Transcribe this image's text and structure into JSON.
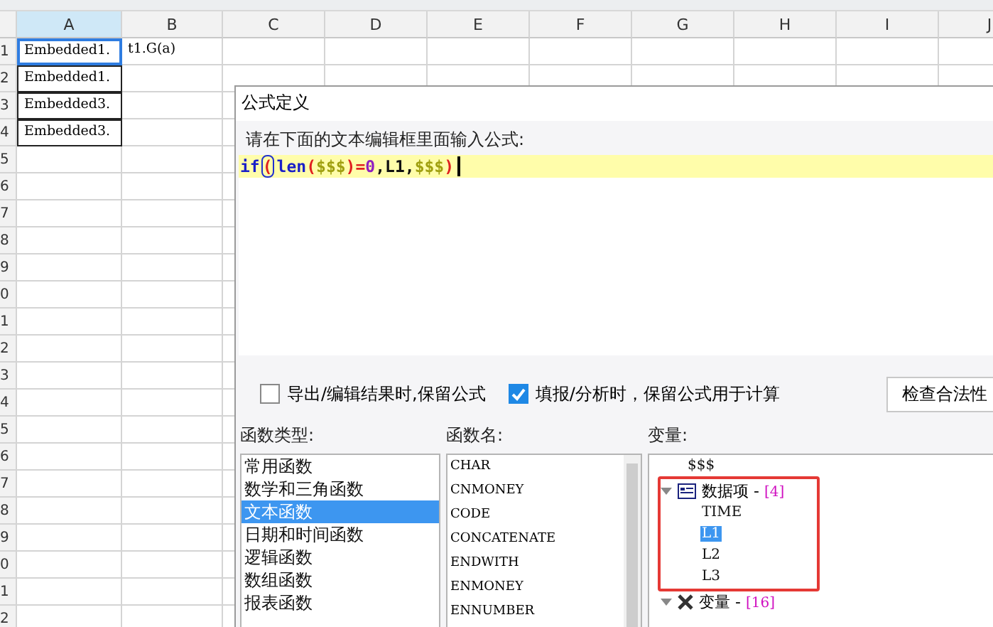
{
  "sheet": {
    "columns": [
      {
        "label": "A",
        "selected": true
      },
      {
        "label": "B",
        "selected": false
      },
      {
        "label": "C",
        "selected": false
      },
      {
        "label": "D",
        "selected": false
      },
      {
        "label": "E",
        "selected": false
      },
      {
        "label": "F",
        "selected": false
      },
      {
        "label": "G",
        "selected": false
      },
      {
        "label": "H",
        "selected": false
      },
      {
        "label": "I",
        "selected": false
      },
      {
        "label": "J",
        "selected": false
      }
    ],
    "rows": [
      {
        "label": "1",
        "cells": [
          {
            "text": "Embedded1.",
            "selected": true
          },
          {
            "text": "t1.G(a)",
            "selected": false
          }
        ]
      },
      {
        "label": "2",
        "cells": [
          {
            "text": "Embedded1.",
            "selected": false
          }
        ]
      },
      {
        "label": "3",
        "cells": [
          {
            "text": "Embedded3.",
            "selected": false
          }
        ]
      },
      {
        "label": "4",
        "cells": [
          {
            "text": "Embedded3.",
            "selected": false
          }
        ]
      },
      {
        "label": "5"
      },
      {
        "label": "6"
      },
      {
        "label": "7"
      },
      {
        "label": "8"
      },
      {
        "label": "9"
      },
      {
        "label": "0"
      },
      {
        "label": "1"
      },
      {
        "label": "2"
      },
      {
        "label": "3"
      },
      {
        "label": "4"
      },
      {
        "label": "5"
      },
      {
        "label": "6"
      },
      {
        "label": "7"
      },
      {
        "label": "8"
      },
      {
        "label": "9"
      },
      {
        "label": "0"
      },
      {
        "label": "1"
      },
      {
        "label": "2"
      }
    ]
  },
  "dialog": {
    "title": "公式定义",
    "prompt": "请在下面的文本编辑框里面输入公式:",
    "formula": [
      {
        "kind": "keyword",
        "text": "if"
      },
      {
        "kind": "bracket-match",
        "text": "("
      },
      {
        "kind": "keyword",
        "text": "len"
      },
      {
        "kind": "bracket",
        "text": "("
      },
      {
        "kind": "variable",
        "text": "$$$"
      },
      {
        "kind": "bracket",
        "text": ")"
      },
      {
        "kind": "operator",
        "text": "="
      },
      {
        "kind": "number",
        "text": "0"
      },
      {
        "kind": "plain",
        "text": ",L1,"
      },
      {
        "kind": "variable",
        "text": "$$$"
      },
      {
        "kind": "bracket",
        "text": ")"
      }
    ],
    "options": [
      {
        "label": "导出/编辑结果时,保留公式",
        "checked": false
      },
      {
        "label": "填报/分析时，保留公式用于计算",
        "checked": true
      }
    ],
    "check_button": "检查合法性",
    "function_types": {
      "label": "函数类型:",
      "items": [
        {
          "label": "常用函数",
          "selected": false
        },
        {
          "label": "数学和三角函数",
          "selected": false
        },
        {
          "label": "文本函数",
          "selected": true
        },
        {
          "label": "日期和时间函数",
          "selected": false
        },
        {
          "label": "逻辑函数",
          "selected": false
        },
        {
          "label": "数组函数",
          "selected": false
        },
        {
          "label": "报表函数",
          "selected": false
        }
      ]
    },
    "function_names": {
      "label": "函数名:",
      "items": [
        "CHAR",
        "CNMONEY",
        "CODE",
        "CONCATENATE",
        "ENDWITH",
        "ENMONEY",
        "ENNUMBER"
      ]
    },
    "variables": {
      "label": "变量:",
      "items": [
        {
          "label": "$$$",
          "kind": "leaf",
          "selected": false
        },
        {
          "label": "数据项 - ",
          "count": "[4]",
          "kind": "dataset",
          "expanded": true,
          "highlighted": true,
          "children": [
            {
              "label": "TIME",
              "selected": false
            },
            {
              "label": "L1",
              "selected": true
            },
            {
              "label": "L2",
              "selected": false
            },
            {
              "label": "L3",
              "selected": false
            }
          ]
        },
        {
          "label": "变量 - ",
          "count": "[16]",
          "kind": "variables",
          "expanded": true,
          "highlighted": false
        }
      ]
    }
  }
}
